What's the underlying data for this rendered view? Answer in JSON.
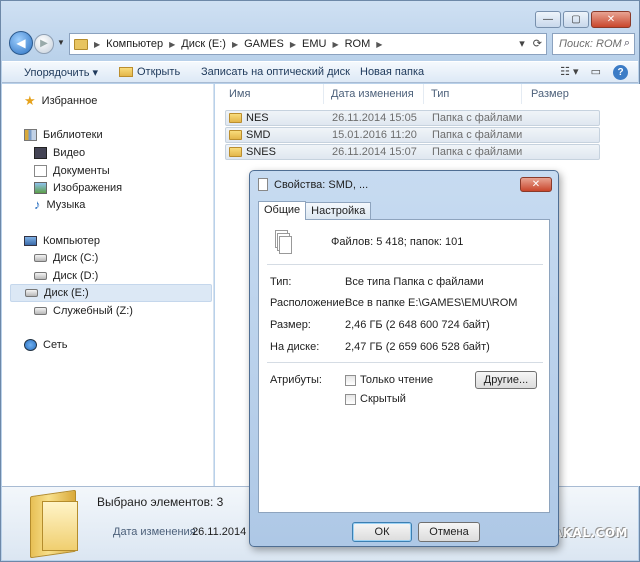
{
  "window": {
    "buttons": {
      "minimize": "—",
      "maximize": "▢",
      "close": "✕"
    }
  },
  "address": {
    "segments": [
      "Компьютер",
      "Диск (E:)",
      "GAMES",
      "EMU",
      "ROM"
    ],
    "search_placeholder": "Поиск: ROM"
  },
  "toolbar": {
    "organize": "Упорядочить ▾",
    "open": "Открыть",
    "burn": "Записать на оптический диск",
    "new_folder": "Новая папка"
  },
  "nav": {
    "favorites": "Избранное",
    "libraries": "Библиотеки",
    "video": "Видео",
    "documents": "Документы",
    "images": "Изображения",
    "music": "Музыка",
    "computer": "Компьютер",
    "disk_c": "Диск (C:)",
    "disk_d": "Диск (D:)",
    "disk_e": "Диск (E:)",
    "disk_z": "Служебный (Z:)",
    "network": "Сеть"
  },
  "columns": {
    "name": "Имя",
    "date": "Дата изменения",
    "type": "Тип",
    "size": "Размер"
  },
  "files": [
    {
      "name": "NES",
      "date": "26.11.2014 15:05",
      "type": "Папка с файлами"
    },
    {
      "name": "SMD",
      "date": "15.01.2016 11:20",
      "type": "Папка с файлами"
    },
    {
      "name": "SNES",
      "date": "26.11.2014 15:07",
      "type": "Папка с файлами"
    }
  ],
  "details": {
    "selected": "Выбрано элементов: 3",
    "date_label": "Дата изменения:",
    "date_value": "26.11.2014 15"
  },
  "watermark": "YAPLAKAL.COM",
  "dialog": {
    "title": "Свойства: SMD, ...",
    "close": "✕",
    "tab_general": "Общие",
    "tab_settings": "Настройка",
    "files_count": "Файлов: 5 418; папок: 101",
    "type_label": "Тип:",
    "type_value": "Все типа Папка с файлами",
    "location_label": "Расположение:",
    "location_value": "Все в папке E:\\GAMES\\EMU\\ROM",
    "size_label": "Размер:",
    "size_value": "2,46 ГБ (2 648 600 724 байт)",
    "disk_label": "На диске:",
    "disk_value": "2,47 ГБ (2 659 606 528 байт)",
    "attributes_label": "Атрибуты:",
    "readonly_label": "Только чтение",
    "hidden_label": "Скрытый",
    "other_button": "Другие...",
    "ok_button": "ОК",
    "cancel_button": "Отмена"
  }
}
